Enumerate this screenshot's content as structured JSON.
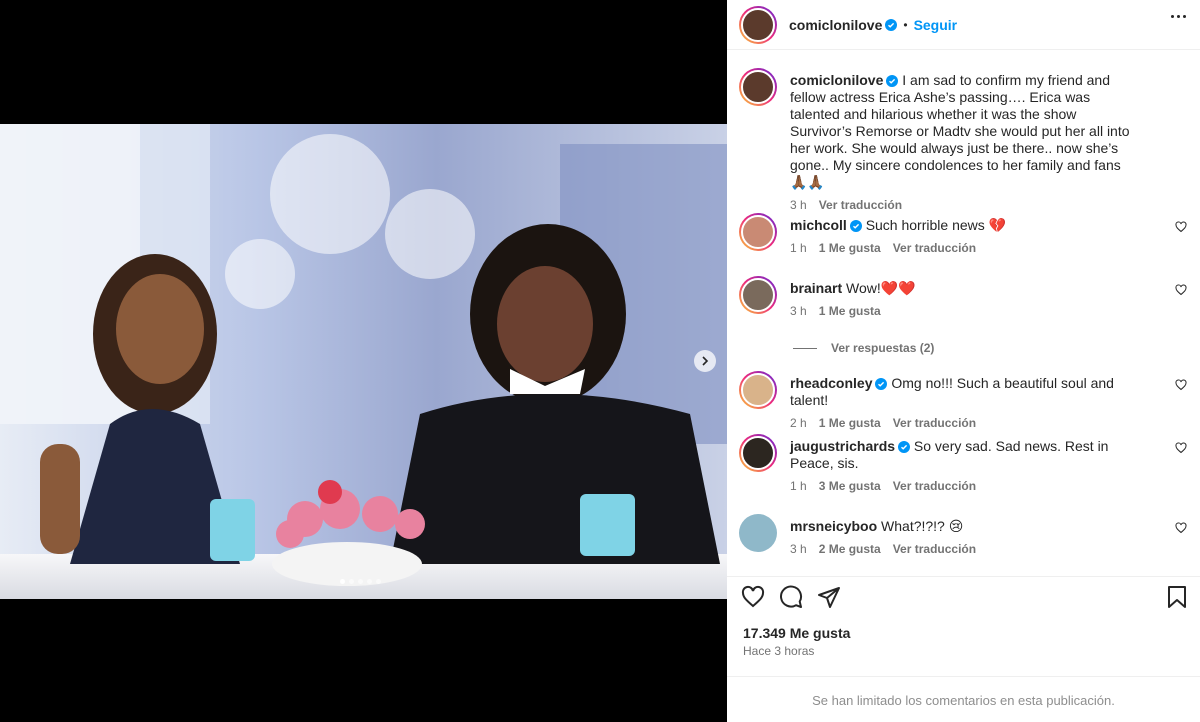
{
  "post": {
    "author": "comiclonilove",
    "dot": "•",
    "follow_label": "Seguir",
    "caption": "I am sad to confirm my friend and fellow actress Erica Ashe’s passing…. Erica was talented and hilarious whether it was the show Survivor’s Remorse or Madtv she would put her all into her work. She would always just be there.. now she’s gone.. My sincere condolences to her family and fans 🙏🏾🙏🏾",
    "caption_time": "3 h",
    "translate_label": "Ver traducción"
  },
  "comments": [
    {
      "user": "michcoll",
      "verified": true,
      "text": "Such horrible news 💔",
      "time": "1 h",
      "likes": "1 Me gusta",
      "translate": "Ver traducción"
    },
    {
      "user": "brainart",
      "verified": false,
      "text": "Wow!❤️❤️",
      "time": "3 h",
      "likes": "1 Me gusta",
      "translate": ""
    },
    {
      "user": "rheadconley",
      "verified": true,
      "text": "Omg no!!! Such a beautiful soul and talent!",
      "time": "2 h",
      "likes": "1 Me gusta",
      "translate": "Ver traducción"
    },
    {
      "user": "jaugustrichards",
      "verified": true,
      "text": "So very sad. Sad news. Rest in Peace, sis.",
      "time": "1 h",
      "likes": "3 Me gusta",
      "translate": "Ver traducción"
    },
    {
      "user": "mrsneicyboo",
      "verified": false,
      "text": "What?!?!? 😢",
      "time": "3 h",
      "likes": "2 Me gusta",
      "translate": "Ver traducción"
    }
  ],
  "view_replies_label": "Ver respuestas (2)",
  "footer": {
    "likes_count": "17.349 Me gusta",
    "posted_time": "Hace 3 horas",
    "limited_notice": "Se han limitado los comentarios en esta publicación."
  },
  "colors": {
    "accent": "#0095f6",
    "text": "#262626",
    "muted": "#737373",
    "heart": "#ed4956"
  },
  "icons": [
    "verified-badge-icon",
    "more-options-icon",
    "heart-icon",
    "comment-icon",
    "share-icon",
    "bookmark-icon",
    "chevron-right-icon"
  ]
}
